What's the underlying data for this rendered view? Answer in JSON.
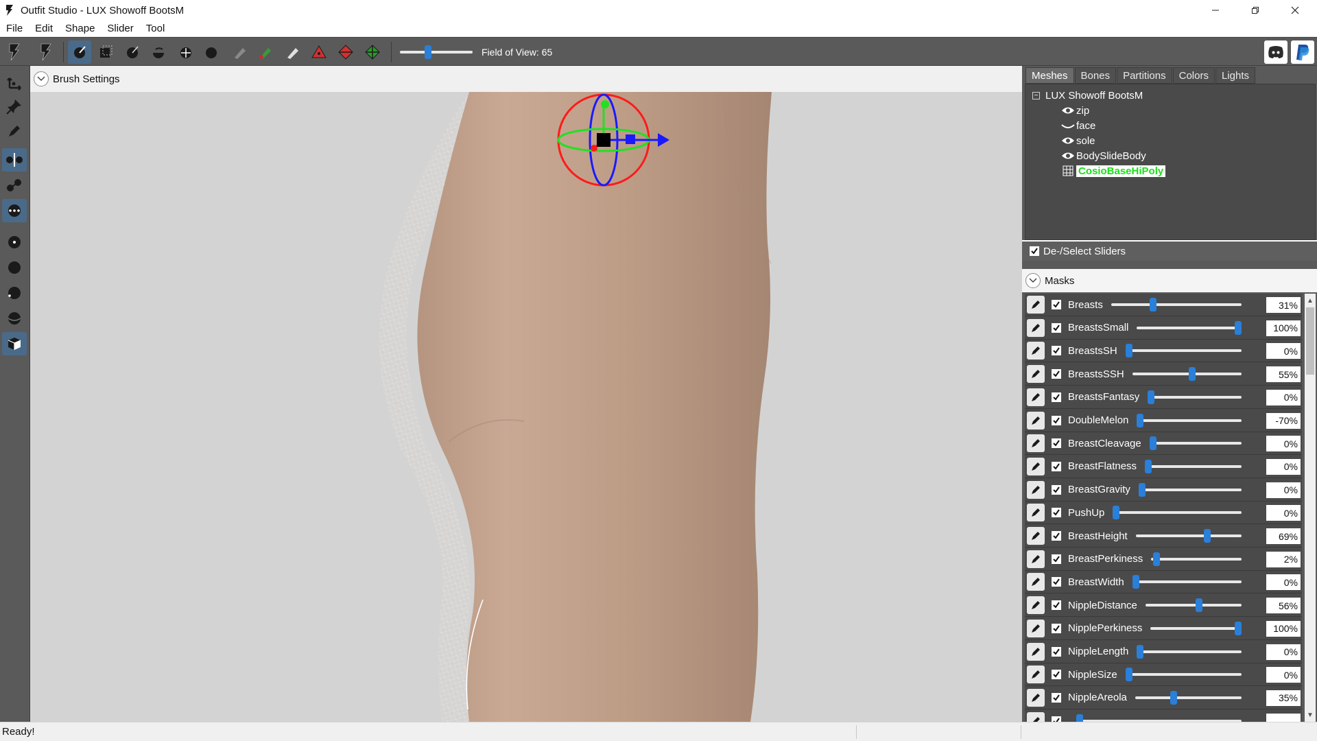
{
  "window": {
    "title": "Outfit Studio - LUX Showoff BootsM",
    "minimize_icon": "minimize-icon",
    "maximize_icon": "restore-icon",
    "close_icon": "close-icon"
  },
  "menu": [
    "File",
    "Edit",
    "Shape",
    "Slider",
    "Tool"
  ],
  "toolbar": {
    "fov_label": "Field of View: 65",
    "fov_value": 65,
    "fov_fraction": 0.37,
    "accent": "#2a7fd8"
  },
  "brush_settings": {
    "label": "Brush Settings"
  },
  "panel": {
    "tabs": [
      "Meshes",
      "Bones",
      "Partitions",
      "Colors",
      "Lights"
    ],
    "active_tab": "Meshes",
    "tree": {
      "root": "LUX Showoff BootsM",
      "items": [
        {
          "label": "zip",
          "icon": "eye-icon"
        },
        {
          "label": "face",
          "icon": "eye-closed-icon"
        },
        {
          "label": "sole",
          "icon": "eye-icon"
        },
        {
          "label": "BodySlideBody",
          "icon": "eye-icon"
        },
        {
          "label": "CosioBaseHiPoly",
          "icon": "wireframe-icon",
          "selected": true
        }
      ]
    },
    "deselect_label": "De-/Select Sliders",
    "masks_label": "Masks"
  },
  "sliders": [
    {
      "name": "Breasts",
      "value": "31%",
      "pos": 0.31
    },
    {
      "name": "BreastsSmall",
      "value": "100%",
      "pos": 1.0
    },
    {
      "name": "BreastsSH",
      "value": "0%",
      "pos": 0.0
    },
    {
      "name": "BreastsSSH",
      "value": "55%",
      "pos": 0.55
    },
    {
      "name": "BreastsFantasy",
      "value": "0%",
      "pos": 0.0
    },
    {
      "name": "DoubleMelon",
      "value": "-70%",
      "pos": 0.0
    },
    {
      "name": "BreastCleavage",
      "value": "0%",
      "pos": 0.0
    },
    {
      "name": "BreastFlatness",
      "value": "0%",
      "pos": 0.0
    },
    {
      "name": "BreastGravity",
      "value": "0%",
      "pos": 0.0
    },
    {
      "name": "PushUp",
      "value": "0%",
      "pos": 0.0
    },
    {
      "name": "BreastHeight",
      "value": "69%",
      "pos": 0.69
    },
    {
      "name": "BreastPerkiness",
      "value": "2%",
      "pos": 0.02
    },
    {
      "name": "BreastWidth",
      "value": "0%",
      "pos": 0.0
    },
    {
      "name": "NippleDistance",
      "value": "56%",
      "pos": 0.56
    },
    {
      "name": "NipplePerkiness",
      "value": "100%",
      "pos": 1.0
    },
    {
      "name": "NippleLength",
      "value": "0%",
      "pos": 0.0
    },
    {
      "name": "NippleSize",
      "value": "0%",
      "pos": 0.0
    },
    {
      "name": "NippleAreola",
      "value": "35%",
      "pos": 0.35
    },
    {
      "name": "",
      "value": "",
      "pos": 0.0
    }
  ],
  "status": {
    "text": "Ready!"
  }
}
